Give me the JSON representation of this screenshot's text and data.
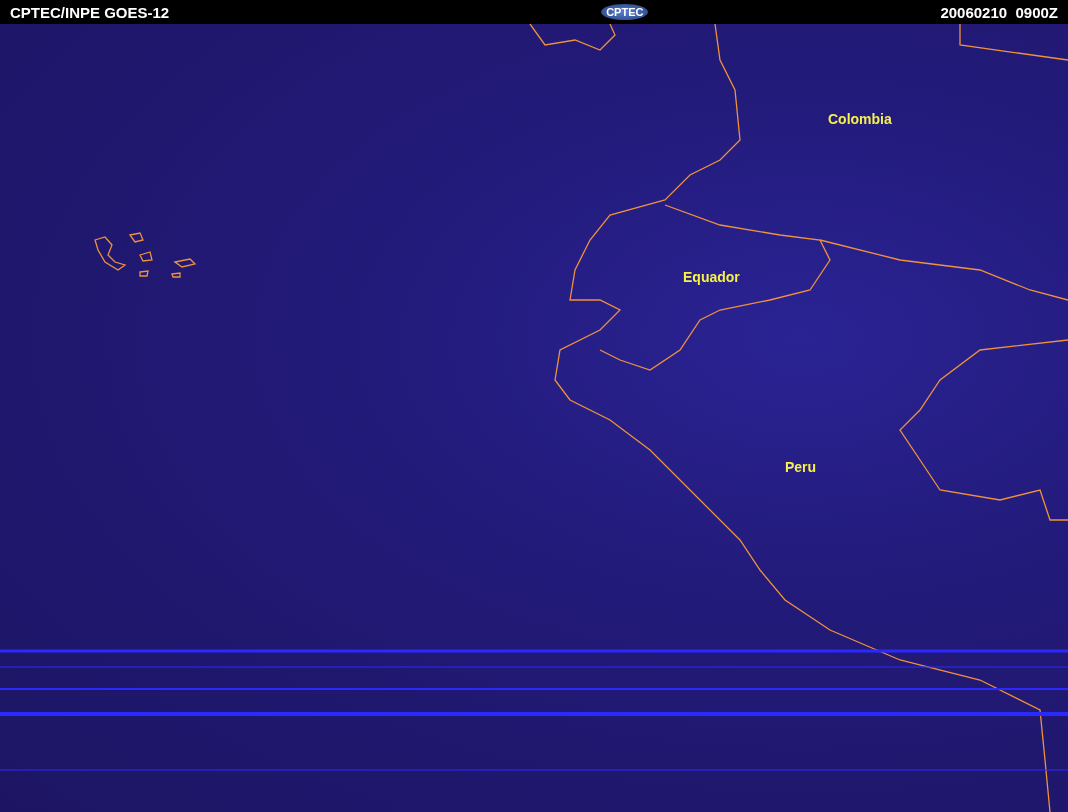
{
  "header": {
    "title": "CPTEC/INPE GOES-12",
    "logo": "CPTEC",
    "timestamp": "20060210  0900Z"
  },
  "map": {
    "labels": [
      {
        "text": "Colombia"
      },
      {
        "text": "Equador"
      },
      {
        "text": "Peru"
      }
    ]
  }
}
